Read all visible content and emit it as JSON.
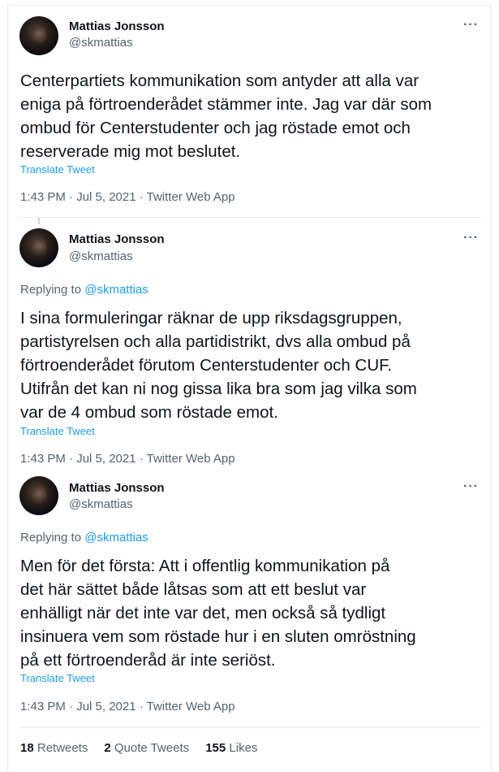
{
  "tweets": [
    {
      "name": "Mattias Jonsson",
      "handle": "@skmattias",
      "more": "···",
      "replying_label": "",
      "replying_to": "",
      "text_lines": [
        "Centerpartiets kommunikation som antyder att alla var",
        "eniga på förtroenderådet stämmer inte. Jag var där som",
        "ombud för Centerstudenter och jag röstade emot och",
        "reserverade mig mot beslutet."
      ],
      "translate": "Translate Tweet",
      "meta": "1:43 PM · Jul 5, 2021 · Twitter Web App"
    },
    {
      "name": "Mattias Jonsson",
      "handle": "@skmattias",
      "more": "···",
      "replying_label": "Replying to ",
      "replying_to": "@skmattias",
      "text_lines": [
        "I sina formuleringar räknar de upp riksdagsgruppen,",
        "partistyrelsen och alla partidistrikt, dvs alla ombud på",
        "förtroenderådet förutom Centerstudenter och CUF.",
        "Utifrån det kan ni nog gissa lika bra som jag vilka som",
        "var de 4 ombud som röstade emot."
      ],
      "translate": "Translate Tweet",
      "meta": "1:43 PM · Jul 5, 2021 · Twitter Web App"
    },
    {
      "name": "Mattias Jonsson",
      "handle": "@skmattias",
      "more": "···",
      "replying_label": "Replying to ",
      "replying_to": "@skmattias",
      "text_lines": [
        "Men för det första: Att i offentlig kommunikation på",
        "det här sättet både låtsas som att ett beslut var",
        "enhälligt när det inte var det, men också så tydligt",
        "insinuera vem som röstade hur i en sluten omröstning",
        "på ett förtroenderåd är inte seriöst."
      ],
      "translate": "Translate Tweet",
      "meta": "1:43 PM · Jul 5, 2021 · Twitter Web App"
    }
  ],
  "stats": {
    "retweets_count": "18",
    "retweets_label": "Retweets",
    "quotes_count": "2",
    "quotes_label": "Quote Tweets",
    "likes_count": "155",
    "likes_label": "Likes"
  }
}
